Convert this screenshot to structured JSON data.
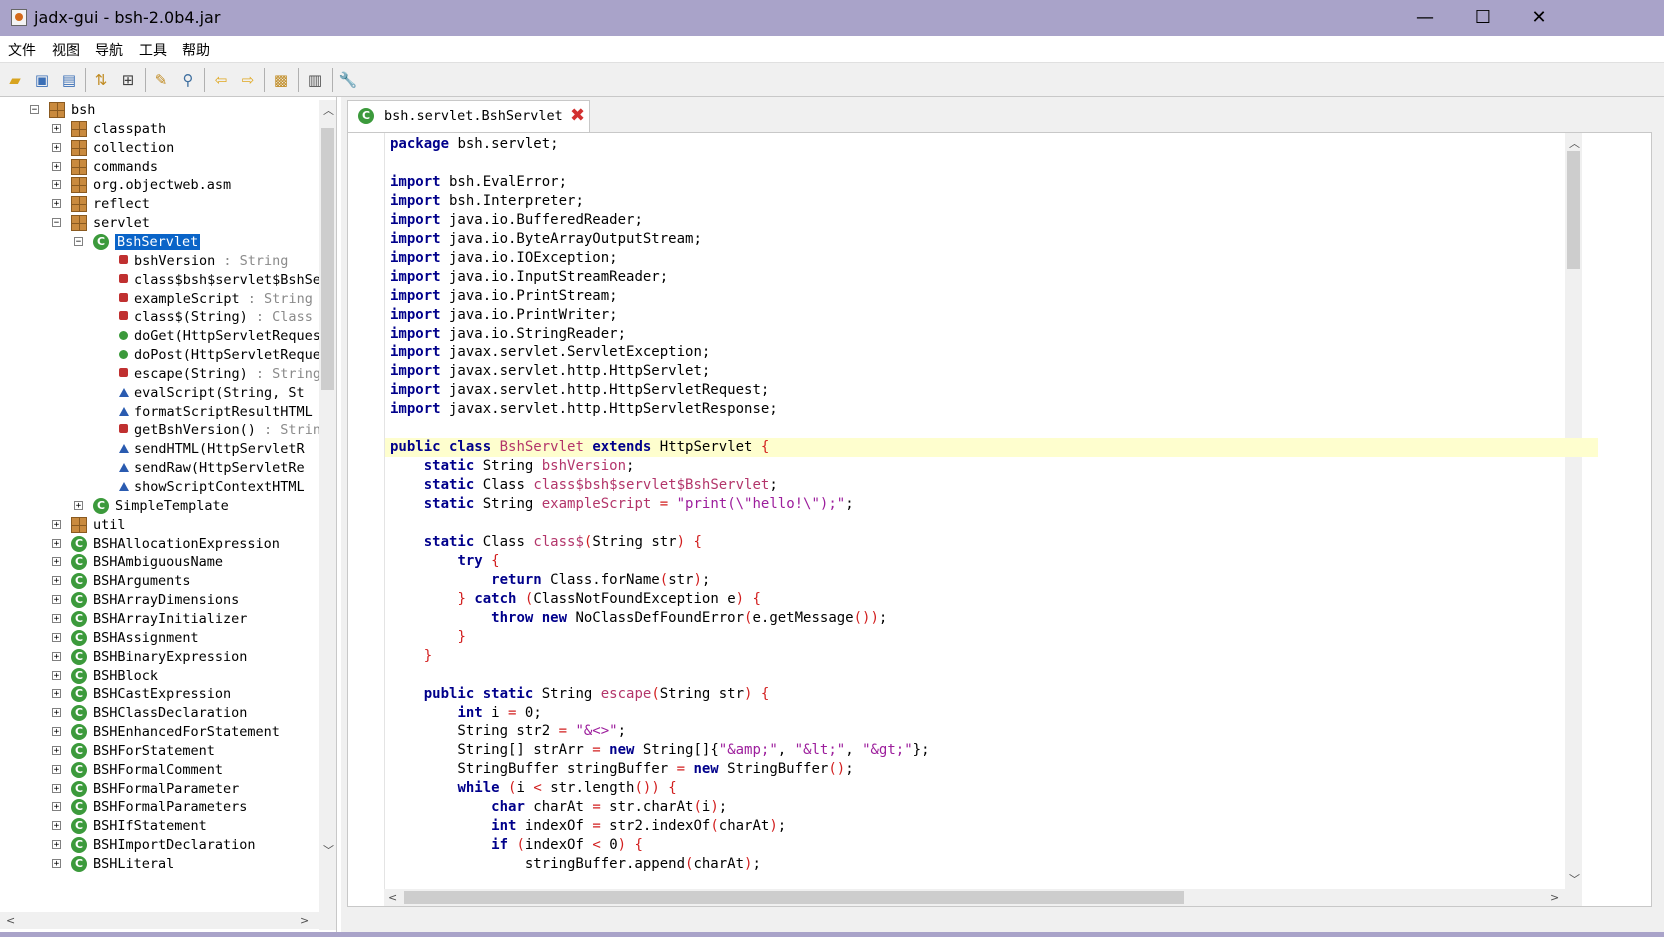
{
  "window": {
    "title": "jadx-gui - bsh-2.0b4.jar",
    "minimize": "—",
    "maximize": "☐",
    "close": "✕"
  },
  "menu": [
    "文件",
    "视图",
    "导航",
    "工具",
    "帮助"
  ],
  "toolbar_icons": [
    "open-file-icon",
    "save-all-icon",
    "export-icon",
    "sync-icon",
    "flatten-icon",
    "decompile-icon",
    "search-icon",
    "back-icon",
    "forward-icon",
    "deobfuscate-icon",
    "log-icon",
    "preferences-icon"
  ],
  "tree": [
    {
      "label": "bsh",
      "kind": "pkg",
      "level": 0,
      "exp": "−"
    },
    {
      "label": "classpath",
      "kind": "pkg",
      "level": 1,
      "exp": "+"
    },
    {
      "label": "collection",
      "kind": "pkg",
      "level": 1,
      "exp": "+"
    },
    {
      "label": "commands",
      "kind": "pkg",
      "level": 1,
      "exp": "+"
    },
    {
      "label": "org.objectweb.asm",
      "kind": "pkg",
      "level": 1,
      "exp": "+"
    },
    {
      "label": "reflect",
      "kind": "pkg",
      "level": 1,
      "exp": "+"
    },
    {
      "label": "servlet",
      "kind": "pkg",
      "level": 1,
      "exp": "−"
    },
    {
      "label": "BshServlet",
      "kind": "cls",
      "level": 2,
      "exp": "−",
      "selected": true
    },
    {
      "label": "bshVersion",
      "suffix": " : String",
      "kind": "fld",
      "level": 3
    },
    {
      "label": "class$bsh$servlet$BshServlet",
      "suffix": "",
      "kind": "fld",
      "level": 3
    },
    {
      "label": "exampleScript",
      "suffix": " : String",
      "kind": "fld",
      "level": 3
    },
    {
      "label": "class$(String)",
      "suffix": " : Class",
      "kind": "fld",
      "level": 3
    },
    {
      "label": "doGet(HttpServletRequest",
      "suffix": "",
      "kind": "mth",
      "level": 3
    },
    {
      "label": "doPost(HttpServletRequest",
      "suffix": "",
      "kind": "mth",
      "level": 3
    },
    {
      "label": "escape(String)",
      "suffix": " : String",
      "kind": "fld",
      "level": 3
    },
    {
      "label": "evalScript(String, St",
      "suffix": "",
      "kind": "tri",
      "level": 3
    },
    {
      "label": "formatScriptResultHTML",
      "suffix": "",
      "kind": "tri",
      "level": 3
    },
    {
      "label": "getBshVersion()",
      "suffix": " : String",
      "kind": "fld",
      "level": 3
    },
    {
      "label": "sendHTML(HttpServletR",
      "suffix": "",
      "kind": "tri",
      "level": 3
    },
    {
      "label": "sendRaw(HttpServletRe",
      "suffix": "",
      "kind": "tri",
      "level": 3
    },
    {
      "label": "showScriptContextHTML",
      "suffix": "",
      "kind": "tri",
      "level": 3
    },
    {
      "label": "SimpleTemplate",
      "kind": "cls",
      "level": 2,
      "exp": "+"
    },
    {
      "label": "util",
      "kind": "pkg",
      "level": 1,
      "exp": "+"
    },
    {
      "label": "BSHAllocationExpression",
      "kind": "cls",
      "level": 1,
      "exp": "+"
    },
    {
      "label": "BSHAmbiguousName",
      "kind": "cls",
      "level": 1,
      "exp": "+"
    },
    {
      "label": "BSHArguments",
      "kind": "cls",
      "level": 1,
      "exp": "+"
    },
    {
      "label": "BSHArrayDimensions",
      "kind": "cls",
      "level": 1,
      "exp": "+"
    },
    {
      "label": "BSHArrayInitializer",
      "kind": "cls",
      "level": 1,
      "exp": "+"
    },
    {
      "label": "BSHAssignment",
      "kind": "cls",
      "level": 1,
      "exp": "+"
    },
    {
      "label": "BSHBinaryExpression",
      "kind": "cls",
      "level": 1,
      "exp": "+"
    },
    {
      "label": "BSHBlock",
      "kind": "cls",
      "level": 1,
      "exp": "+"
    },
    {
      "label": "BSHCastExpression",
      "kind": "cls",
      "level": 1,
      "exp": "+"
    },
    {
      "label": "BSHClassDeclaration",
      "kind": "cls",
      "level": 1,
      "exp": "+"
    },
    {
      "label": "BSHEnhancedForStatement",
      "kind": "cls",
      "level": 1,
      "exp": "+"
    },
    {
      "label": "BSHForStatement",
      "kind": "cls",
      "level": 1,
      "exp": "+"
    },
    {
      "label": "BSHFormalComment",
      "kind": "cls",
      "level": 1,
      "exp": "+"
    },
    {
      "label": "BSHFormalParameter",
      "kind": "cls",
      "level": 1,
      "exp": "+"
    },
    {
      "label": "BSHFormalParameters",
      "kind": "cls",
      "level": 1,
      "exp": "+"
    },
    {
      "label": "BSHIfStatement",
      "kind": "cls",
      "level": 1,
      "exp": "+"
    },
    {
      "label": "BSHImportDeclaration",
      "kind": "cls",
      "level": 1,
      "exp": "+"
    },
    {
      "label": "BSHLiteral",
      "kind": "cls",
      "level": 1,
      "exp": "+"
    }
  ],
  "tab": {
    "label": "bsh.servlet.BshServlet",
    "close": "✖"
  },
  "code": [
    [
      [
        "kw",
        "package"
      ],
      [
        "t",
        " bsh.servlet;"
      ]
    ],
    [],
    [
      [
        "kw",
        "import"
      ],
      [
        "t",
        " bsh.EvalError;"
      ]
    ],
    [
      [
        "kw",
        "import"
      ],
      [
        "t",
        " bsh.Interpreter;"
      ]
    ],
    [
      [
        "kw",
        "import"
      ],
      [
        "t",
        " java.io.BufferedReader;"
      ]
    ],
    [
      [
        "kw",
        "import"
      ],
      [
        "t",
        " java.io.ByteArrayOutputStream;"
      ]
    ],
    [
      [
        "kw",
        "import"
      ],
      [
        "t",
        " java.io.IOException;"
      ]
    ],
    [
      [
        "kw",
        "import"
      ],
      [
        "t",
        " java.io.InputStreamReader;"
      ]
    ],
    [
      [
        "kw",
        "import"
      ],
      [
        "t",
        " java.io.PrintStream;"
      ]
    ],
    [
      [
        "kw",
        "import"
      ],
      [
        "t",
        " java.io.PrintWriter;"
      ]
    ],
    [
      [
        "kw",
        "import"
      ],
      [
        "t",
        " java.io.StringReader;"
      ]
    ],
    [
      [
        "kw",
        "import"
      ],
      [
        "t",
        " javax.servlet.ServletException;"
      ]
    ],
    [
      [
        "kw",
        "import"
      ],
      [
        "t",
        " javax.servlet.http.HttpServlet;"
      ]
    ],
    [
      [
        "kw",
        "import"
      ],
      [
        "t",
        " javax.servlet.http.HttpServletRequest;"
      ]
    ],
    [
      [
        "kw",
        "import"
      ],
      [
        "t",
        " javax.servlet.http.HttpServletResponse;"
      ]
    ],
    [],
    [
      [
        "kw",
        "public class"
      ],
      [
        "t",
        " "
      ],
      [
        "id",
        "BshServlet"
      ],
      [
        "t",
        " "
      ],
      [
        "kw",
        "extends"
      ],
      [
        "t",
        " HttpServlet "
      ],
      [
        "op",
        "{"
      ]
    ],
    [
      [
        "t",
        "    "
      ],
      [
        "kw",
        "static"
      ],
      [
        "t",
        " String "
      ],
      [
        "id",
        "bshVersion"
      ],
      [
        "t",
        ";"
      ]
    ],
    [
      [
        "t",
        "    "
      ],
      [
        "kw",
        "static"
      ],
      [
        "t",
        " Class "
      ],
      [
        "id",
        "class$bsh$servlet$BshServlet"
      ],
      [
        "t",
        ";"
      ]
    ],
    [
      [
        "t",
        "    "
      ],
      [
        "kw",
        "static"
      ],
      [
        "t",
        " String "
      ],
      [
        "id",
        "exampleScript"
      ],
      [
        "t",
        " "
      ],
      [
        "op",
        "="
      ],
      [
        "t",
        " "
      ],
      [
        "str",
        "\"print(\\\"hello!\\\");\""
      ],
      [
        "t",
        ";"
      ]
    ],
    [],
    [
      [
        "t",
        "    "
      ],
      [
        "kw",
        "static"
      ],
      [
        "t",
        " Class "
      ],
      [
        "id",
        "class$"
      ],
      [
        "op",
        "("
      ],
      [
        "t",
        "String str"
      ],
      [
        "op",
        ")"
      ],
      [
        "t",
        " "
      ],
      [
        "op",
        "{"
      ]
    ],
    [
      [
        "t",
        "        "
      ],
      [
        "kw",
        "try"
      ],
      [
        "t",
        " "
      ],
      [
        "op",
        "{"
      ]
    ],
    [
      [
        "t",
        "            "
      ],
      [
        "kw",
        "return"
      ],
      [
        "t",
        " Class.forName"
      ],
      [
        "op",
        "("
      ],
      [
        "t",
        "str"
      ],
      [
        "op",
        ")"
      ],
      [
        "t",
        ";"
      ]
    ],
    [
      [
        "t",
        "        "
      ],
      [
        "op",
        "}"
      ],
      [
        "t",
        " "
      ],
      [
        "kw",
        "catch"
      ],
      [
        "t",
        " "
      ],
      [
        "op",
        "("
      ],
      [
        "t",
        "ClassNotFoundException e"
      ],
      [
        "op",
        ")"
      ],
      [
        "t",
        " "
      ],
      [
        "op",
        "{"
      ]
    ],
    [
      [
        "t",
        "            "
      ],
      [
        "kw",
        "throw new"
      ],
      [
        "t",
        " NoClassDefFoundError"
      ],
      [
        "op",
        "("
      ],
      [
        "t",
        "e.getMessage"
      ],
      [
        "op",
        "())"
      ],
      [
        "t",
        ";"
      ]
    ],
    [
      [
        "t",
        "        "
      ],
      [
        "op",
        "}"
      ]
    ],
    [
      [
        "t",
        "    "
      ],
      [
        "op",
        "}"
      ]
    ],
    [],
    [
      [
        "t",
        "    "
      ],
      [
        "kw",
        "public static"
      ],
      [
        "t",
        " String "
      ],
      [
        "id",
        "escape"
      ],
      [
        "op",
        "("
      ],
      [
        "t",
        "String str"
      ],
      [
        "op",
        ")"
      ],
      [
        "t",
        " "
      ],
      [
        "op",
        "{"
      ]
    ],
    [
      [
        "t",
        "        "
      ],
      [
        "kw",
        "int"
      ],
      [
        "t",
        " i "
      ],
      [
        "op",
        "="
      ],
      [
        "t",
        " 0;"
      ]
    ],
    [
      [
        "t",
        "        String str2 "
      ],
      [
        "op",
        "="
      ],
      [
        "t",
        " "
      ],
      [
        "str",
        "\"&<>\""
      ],
      [
        "t",
        ";"
      ]
    ],
    [
      [
        "t",
        "        String[] strArr "
      ],
      [
        "op",
        "="
      ],
      [
        "t",
        " "
      ],
      [
        "kw",
        "new"
      ],
      [
        "t",
        " String[]{"
      ],
      [
        "str",
        "\"&amp;\""
      ],
      [
        "t",
        ", "
      ],
      [
        "str",
        "\"&lt;\""
      ],
      [
        "t",
        ", "
      ],
      [
        "str",
        "\"&gt;\""
      ],
      [
        "t",
        "};"
      ]
    ],
    [
      [
        "t",
        "        StringBuffer stringBuffer "
      ],
      [
        "op",
        "="
      ],
      [
        "t",
        " "
      ],
      [
        "kw",
        "new"
      ],
      [
        "t",
        " StringBuffer"
      ],
      [
        "op",
        "()"
      ],
      [
        "t",
        ";"
      ]
    ],
    [
      [
        "t",
        "        "
      ],
      [
        "kw",
        "while"
      ],
      [
        "t",
        " "
      ],
      [
        "op",
        "("
      ],
      [
        "t",
        "i "
      ],
      [
        "op",
        "<"
      ],
      [
        "t",
        " str.length"
      ],
      [
        "op",
        "())"
      ],
      [
        "t",
        " "
      ],
      [
        "op",
        "{"
      ]
    ],
    [
      [
        "t",
        "            "
      ],
      [
        "kw",
        "char"
      ],
      [
        "t",
        " charAt "
      ],
      [
        "op",
        "="
      ],
      [
        "t",
        " str.charAt"
      ],
      [
        "op",
        "("
      ],
      [
        "t",
        "i"
      ],
      [
        "op",
        ")"
      ],
      [
        "t",
        ";"
      ]
    ],
    [
      [
        "t",
        "            "
      ],
      [
        "kw",
        "int"
      ],
      [
        "t",
        " indexOf "
      ],
      [
        "op",
        "="
      ],
      [
        "t",
        " str2.indexOf"
      ],
      [
        "op",
        "("
      ],
      [
        "t",
        "charAt"
      ],
      [
        "op",
        ")"
      ],
      [
        "t",
        ";"
      ]
    ],
    [
      [
        "t",
        "            "
      ],
      [
        "kw",
        "if"
      ],
      [
        "t",
        " "
      ],
      [
        "op",
        "("
      ],
      [
        "t",
        "indexOf "
      ],
      [
        "op",
        "<"
      ],
      [
        "t",
        " 0"
      ],
      [
        "op",
        ")"
      ],
      [
        "t",
        " "
      ],
      [
        "op",
        "{"
      ]
    ],
    [
      [
        "t",
        "                stringBuffer.append"
      ],
      [
        "op",
        "("
      ],
      [
        "t",
        "charAt"
      ],
      [
        "op",
        ")"
      ],
      [
        "t",
        ";"
      ]
    ]
  ]
}
